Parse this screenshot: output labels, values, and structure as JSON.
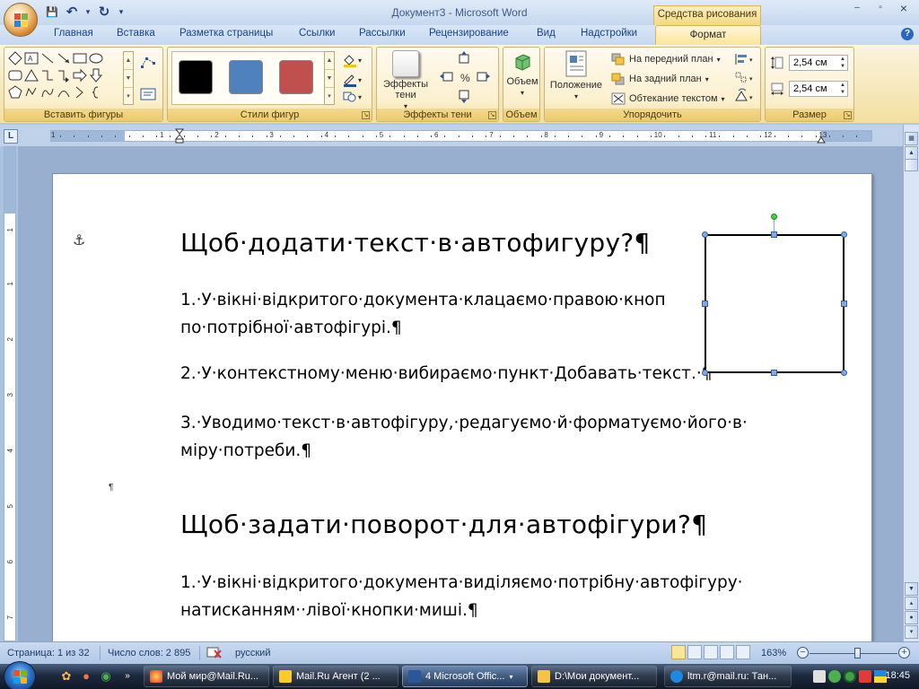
{
  "window": {
    "title": "Документ3 - Microsoft Word",
    "context_tab": "Средства рисования",
    "controls": {
      "minimize": "–",
      "maximize": "▫",
      "close": "×"
    }
  },
  "qat": {
    "save": "💾",
    "undo": "↶",
    "redo": "↻",
    "customize": "▾"
  },
  "tabs": [
    {
      "label": "Главная"
    },
    {
      "label": "Вставка"
    },
    {
      "label": "Разметка страницы"
    },
    {
      "label": "Ссылки"
    },
    {
      "label": "Рассылки"
    },
    {
      "label": "Рецензирование"
    },
    {
      "label": "Вид"
    },
    {
      "label": "Надстройки"
    },
    {
      "label": "Формат"
    }
  ],
  "ribbon": {
    "groups": {
      "insert_shapes": "Вставить фигуры",
      "shape_styles": "Стили фигур",
      "shadow_effects": "Эффекты тени",
      "3d": "Объем",
      "arrange": "Упорядочить",
      "size": "Размер"
    },
    "shadow_btn": "Эффекты тени",
    "volume_btn": "Объем",
    "position_btn": "Положение",
    "bring_front": "На передний план",
    "send_back": "На задний план",
    "text_wrap": "Обтекание текстом",
    "height_value": "2,54 см",
    "width_value": "2,54 см",
    "swatch_colors": [
      "#000000",
      "#4f81bd",
      "#c0504d"
    ]
  },
  "ruler": {
    "numbers": [
      "1",
      "1",
      "2",
      "3",
      "4",
      "5",
      "6",
      "7",
      "8",
      "9",
      "10",
      "11",
      "12",
      "13"
    ]
  },
  "vruler": {
    "numbers": [
      "1",
      "1",
      "2",
      "3",
      "4",
      "5",
      "6",
      "7"
    ]
  },
  "document": {
    "heading1": "Щоб·додати·текст·в·автофигуру?¶",
    "p1": "1.·У·вікні·відкритого·документа·клацаємо·правою·кноп\nпо·потрібної·автофігурі.¶",
    "p2": "2.·У·контекстному·меню·вибираємо·пункт·Добавать·текст.·¶",
    "p3": "3.·Уводимо·текст·в·автофігуру,·редагуємо·й·форматуємо·його·в·\nміру·потреби.¶",
    "empty_para": "¶",
    "heading2": "Щоб·задати·поворот·для·автофігури?¶",
    "p4": "1.·У·вікні·відкритого·документа·виділяємо·потрібну·автофігуру·\nнатисканням··лівої·кнопки·миші.¶"
  },
  "status": {
    "page": "Страница: 1 из 32",
    "words": "Число слов: 2 895",
    "language": "русский",
    "zoom": "163%",
    "zoom_level": 0.55
  },
  "taskbar": {
    "tasks": [
      {
        "label": "Мой мир@Mail.Ru..."
      },
      {
        "label": "Mail.Ru Агент (2 ..."
      },
      {
        "label": "4 Microsoft Offic..."
      },
      {
        "label": "D:\\Мои документ..."
      },
      {
        "label": "ltm.r@mail.ru: Тан..."
      }
    ],
    "clock": "18:45"
  }
}
